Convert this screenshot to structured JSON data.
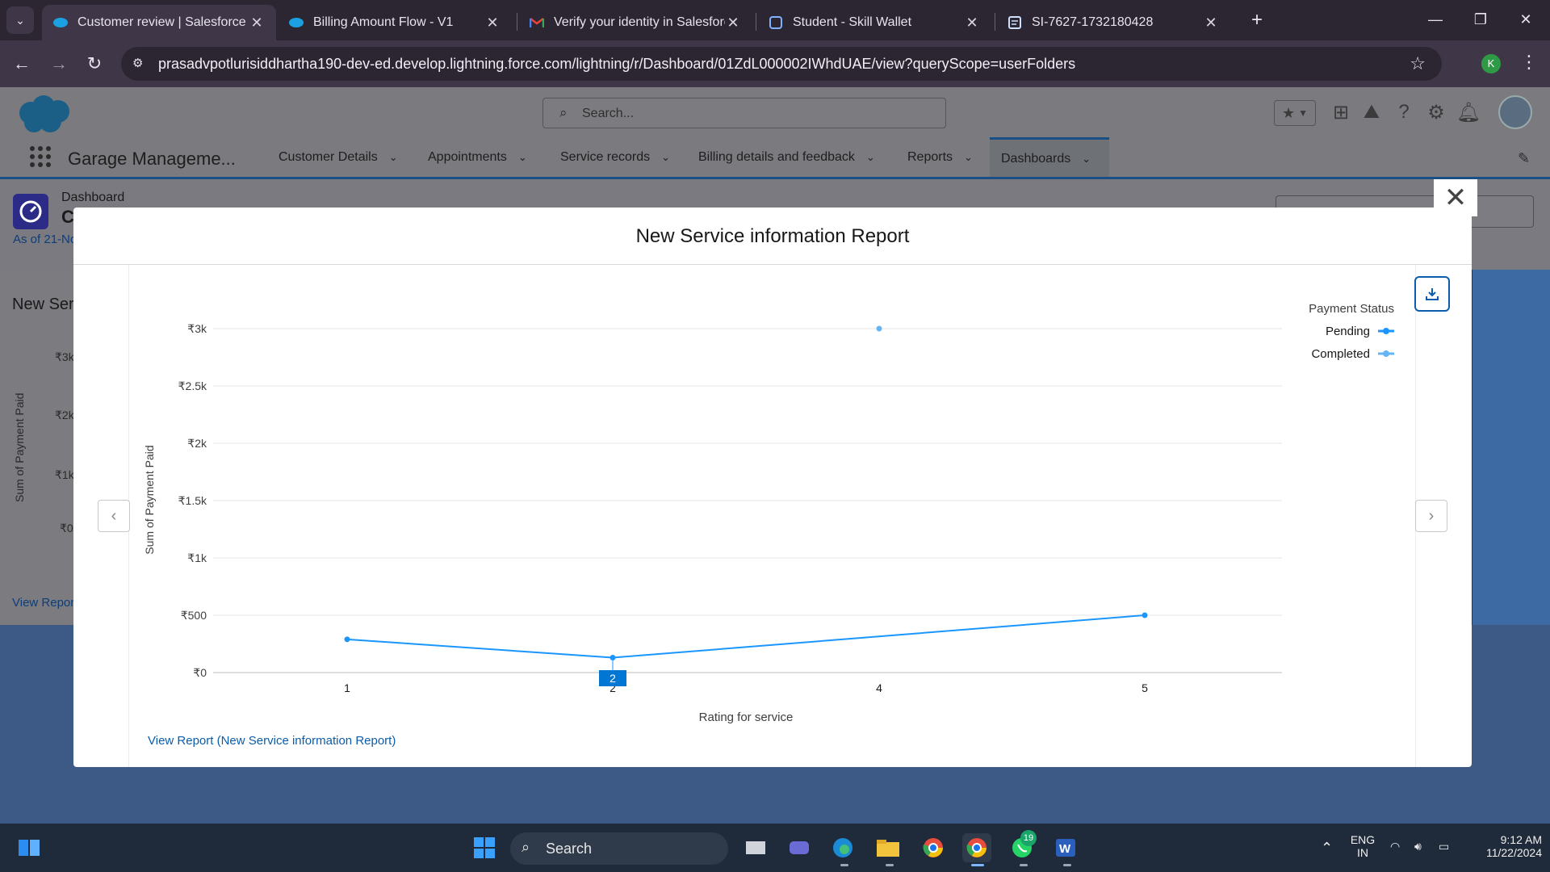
{
  "browser": {
    "tabs": [
      {
        "title": "Customer review | Salesforce",
        "active": true,
        "icon": "salesforce-icon"
      },
      {
        "title": "Billing Amount Flow - V1",
        "active": false,
        "icon": "salesforce-icon"
      },
      {
        "title": "Verify your identity in Salesforce",
        "active": false,
        "icon": "gmail-icon"
      },
      {
        "title": "Student - Skill Wallet",
        "active": false,
        "icon": "skillwallet-icon"
      },
      {
        "title": "SI-7627-1732180428",
        "active": false,
        "icon": "document-icon"
      }
    ],
    "url": "prasadvpotlurisiddhartha190-dev-ed.develop.lightning.force.com/lightning/r/Dashboard/01ZdL000002IWhdUAE/view?queryScope=userFolders",
    "profile_initial": "K"
  },
  "sf": {
    "search_placeholder": "Search...",
    "app_name": "Garage Manageme...",
    "nav": [
      {
        "label": "Customer Details"
      },
      {
        "label": "Appointments"
      },
      {
        "label": "Service records"
      },
      {
        "label": "Billing details and feedback"
      },
      {
        "label": "Reports"
      },
      {
        "label": "Dashboards",
        "active": true
      }
    ]
  },
  "dashboard": {
    "label": "Dashboard",
    "title_fragment": "C",
    "as_of": "As of 21-No",
    "panel_title": "New Ser",
    "panel_ticks": [
      "₹3k",
      "₹2k",
      "₹1k",
      "₹0"
    ],
    "panel_axis": "Sum of Payment Paid",
    "panel_link": "View Repor"
  },
  "modal": {
    "title": "New Service information Report",
    "view_report": "View Report (New Service information Report)",
    "close_glyph": "✕"
  },
  "chart_data": {
    "type": "line",
    "xlabel": "Rating for service",
    "ylabel": "Sum of Payment Paid",
    "categories": [
      "1",
      "2",
      "4",
      "5"
    ],
    "y_ticks": [
      "₹0",
      "₹500",
      "₹1k",
      "₹1.5k",
      "₹2k",
      "₹2.5k",
      "₹3k"
    ],
    "ylim": [
      0,
      3000
    ],
    "legend_title": "Payment Status",
    "legend_position": "top-right",
    "tooltip_label": "2",
    "series": [
      {
        "name": "Pending",
        "color": "#1b96ff",
        "values": [
          290,
          130,
          null,
          500
        ]
      },
      {
        "name": "Completed",
        "color": "#64b5f6",
        "values": [
          null,
          null,
          3000,
          null
        ]
      }
    ],
    "grid": true
  },
  "taskbar": {
    "search_label": "Search",
    "lang_top": "ENG",
    "lang_bottom": "IN",
    "time": "9:12 AM",
    "date": "11/22/2024",
    "whatsapp_badge": "19"
  }
}
